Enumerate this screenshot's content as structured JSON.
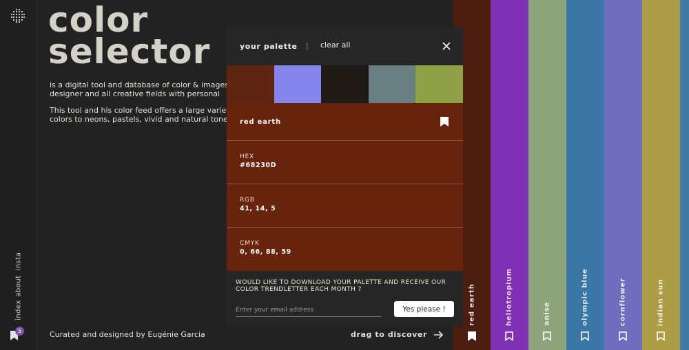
{
  "rail": {
    "links": [
      "insta",
      "about",
      "index"
    ],
    "bookmark_count": "5"
  },
  "hero": {
    "title_line1": "color",
    "title_line2": "selector",
    "para1": "is a digital tool and database of color & images for artist, designer and all creative fields with personal",
    "para2": "This tool and his color feed offers a large variety of basic colors to neons, pastels, vivid and natural tones"
  },
  "footer": {
    "credit": "Curated and designed by Eugénie Garcia",
    "drag": "drag to discover"
  },
  "strips": [
    {
      "name": "red earth",
      "color": "#4b1d0e"
    },
    {
      "name": "heliotropium",
      "color": "#7f31b5"
    },
    {
      "name": "anise",
      "color": "#8ea57b"
    },
    {
      "name": "olympic blue",
      "color": "#3b77a6"
    },
    {
      "name": "cornflower",
      "color": "#6e6dbe"
    },
    {
      "name": "indian sun",
      "color": "#ad9c46"
    },
    {
      "name": "",
      "color": "#3f7ba6"
    }
  ],
  "panel": {
    "title": "your palette",
    "separator": "|",
    "clear": "clear all",
    "swatches": [
      "#5e2513",
      "#8585ec",
      "#1f1a16",
      "#697e80",
      "#8f9f46"
    ],
    "selected": {
      "name": "red earth",
      "color": "#68230d",
      "hex_label": "HEX",
      "hex": "#68230D",
      "rgb_label": "RGB",
      "rgb": "41, 14, 5",
      "cmyk_label": "CMYK",
      "cmyk": "0, 66, 88, 59"
    },
    "newsletter": {
      "text": "WOULD LIKE TO DOWNLOAD YOUR PALETTE AND RECEIVE OUR COLOR TRENDLETTER EACH MONTH ?",
      "placeholder": "Enter your email address",
      "button": "Yes please !"
    }
  }
}
